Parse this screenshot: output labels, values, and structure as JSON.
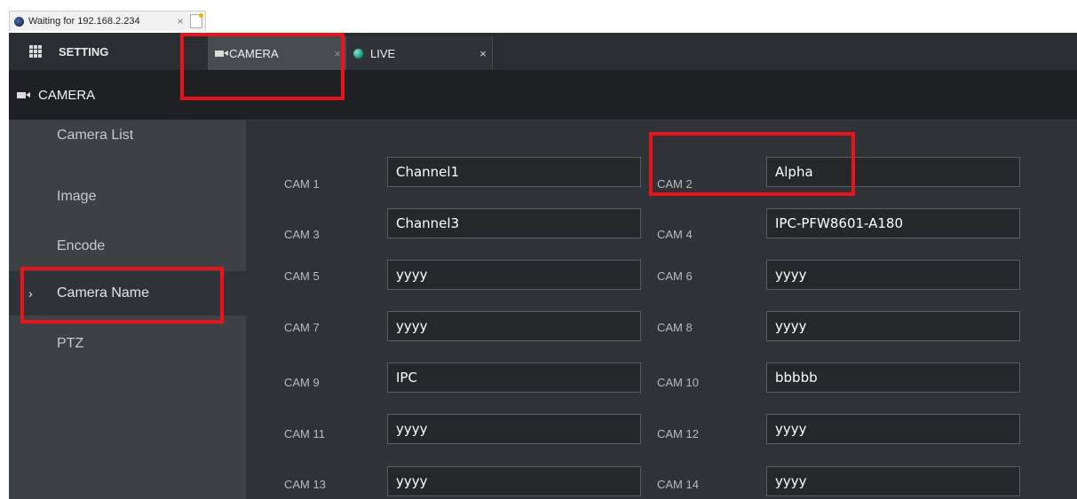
{
  "browser": {
    "tab_title": "Waiting for 192.168.2.234",
    "tab_close": "×"
  },
  "topbar": {
    "setting_label": "SETTING",
    "tabs": [
      {
        "label": "CAMERA",
        "close": "×",
        "active": true
      },
      {
        "label": "LIVE",
        "close": "×",
        "active": false
      }
    ]
  },
  "section": {
    "title": "CAMERA"
  },
  "sidebar": {
    "items": [
      {
        "label": "Camera List"
      },
      {
        "label": "Image"
      },
      {
        "label": "Encode"
      },
      {
        "label": "Camera Name",
        "active": true,
        "marker": "›"
      },
      {
        "label": "PTZ"
      }
    ]
  },
  "cameras": [
    {
      "label": "CAM 1",
      "name": "Channel1"
    },
    {
      "label": "CAM 2",
      "name": "Alpha"
    },
    {
      "label": "CAM 3",
      "name": "Channel3"
    },
    {
      "label": "CAM 4",
      "name": "IPC-PFW8601-A180"
    },
    {
      "label": "CAM 5",
      "name": "yyyy"
    },
    {
      "label": "CAM 6",
      "name": "yyyy"
    },
    {
      "label": "CAM 7",
      "name": "yyyy"
    },
    {
      "label": "CAM 8",
      "name": "yyyy"
    },
    {
      "label": "CAM 9",
      "name": "IPC"
    },
    {
      "label": "CAM 10",
      "name": "bbbbb"
    },
    {
      "label": "CAM 11",
      "name": "yyyy"
    },
    {
      "label": "CAM 12",
      "name": "yyyy"
    },
    {
      "label": "CAM 13",
      "name": "yyyy"
    },
    {
      "label": "CAM 14",
      "name": "yyyy"
    }
  ],
  "icons": {
    "browser_tab": "globe-icon",
    "setting": "grid-icon",
    "camera": "camera-icon",
    "live": "live-icon"
  },
  "colors": {
    "highlight": "#e8141a",
    "app_background": "#2f3237",
    "sidebar_background": "#3d4045"
  }
}
